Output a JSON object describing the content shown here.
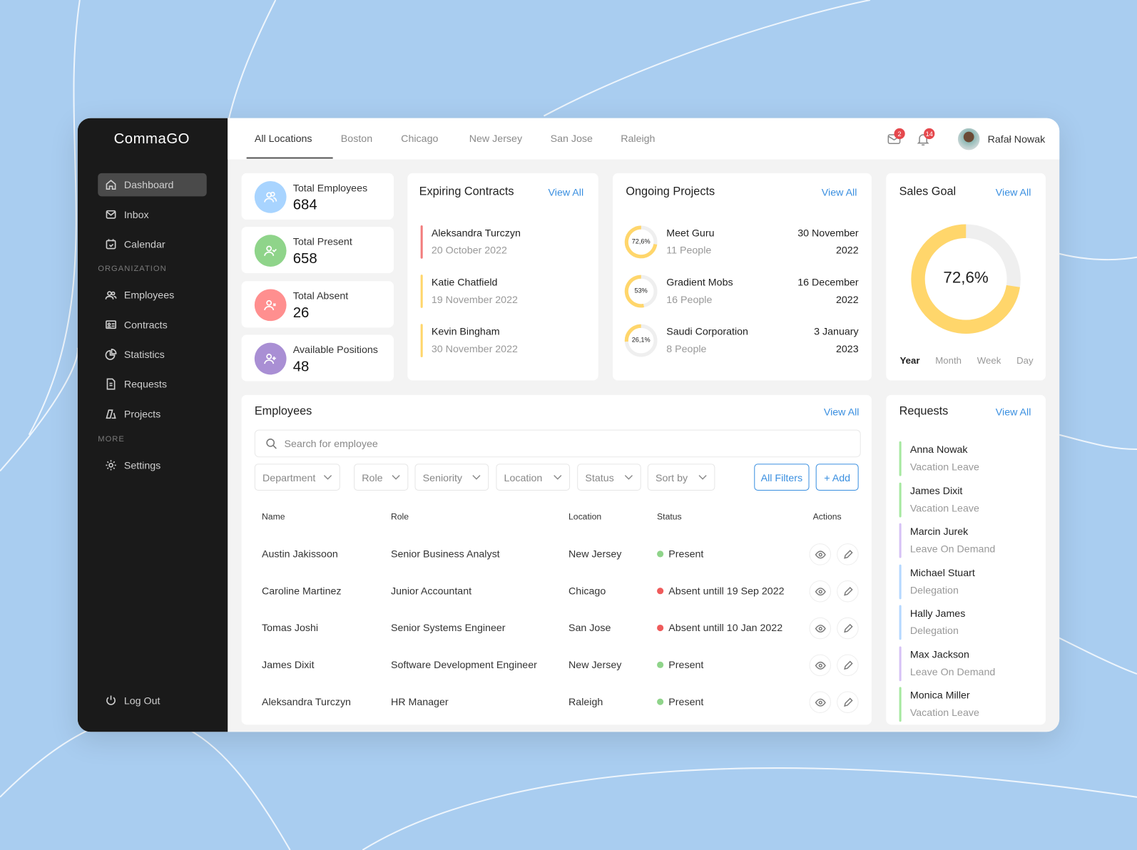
{
  "app": {
    "name": "CommaGO"
  },
  "sidebar": {
    "items": [
      {
        "label": "Dashboard",
        "icon": "home-icon"
      },
      {
        "label": "Inbox",
        "icon": "mail-icon"
      },
      {
        "label": "Calendar",
        "icon": "calendar-icon"
      }
    ],
    "section_org": "ORGANIZATION",
    "org_items": [
      {
        "label": "Employees"
      },
      {
        "label": "Contracts"
      },
      {
        "label": "Statistics"
      },
      {
        "label": "Requests"
      },
      {
        "label": "Projects"
      }
    ],
    "section_more": "MORE",
    "more_items": [
      {
        "label": "Settings"
      }
    ],
    "logout": "Log Out"
  },
  "tabs": [
    "All Locations",
    "Boston",
    "Chicago",
    "New Jersey",
    "San Jose",
    "Raleigh"
  ],
  "header": {
    "mail_count": "2",
    "notif_count": "14",
    "user_name": "Rafał Nowak"
  },
  "stats": [
    {
      "label": "Total Employees",
      "value": "684",
      "color": "#a8d4ff"
    },
    {
      "label": "Total Present",
      "value": "658",
      "color": "#8fd48a"
    },
    {
      "label": "Total Absent",
      "value": "26",
      "color": "#ff8f8f"
    },
    {
      "label": "Available Positions",
      "value": "48",
      "color": "#a98fd4"
    }
  ],
  "contracts": {
    "title": "Expiring Contracts",
    "view_all": "View All",
    "items": [
      {
        "name": "Aleksandra Turczyn",
        "date": "20 October 2022",
        "color": "#f27c7c"
      },
      {
        "name": "Katie Chatfield",
        "date": "19 November 2022",
        "color": "#ffd66b"
      },
      {
        "name": "Kevin Bingham",
        "date": "30 November 2022",
        "color": "#ffd66b"
      }
    ]
  },
  "projects": {
    "title": "Ongoing Projects",
    "view_all": "View All",
    "items": [
      {
        "name": "Meet Guru",
        "people": "11 People",
        "date1": "30 November",
        "date2": "2022",
        "pct_label": "72,6%",
        "pct": 72.6
      },
      {
        "name": "Gradient Mobs",
        "people": "16 People",
        "date1": "16 December",
        "date2": "2022",
        "pct_label": "53%",
        "pct": 53
      },
      {
        "name": "Saudi Corporation",
        "people": "8 People",
        "date1": "3 January",
        "date2": "2023",
        "pct_label": "26,1%",
        "pct": 26.1
      }
    ]
  },
  "sales": {
    "title": "Sales Goal",
    "view_all": "View All",
    "value_label": "72,6%",
    "value": 72.6,
    "periods": [
      "Year",
      "Month",
      "Week",
      "Day"
    ],
    "active_period": "Year"
  },
  "employees": {
    "title": "Employees",
    "view_all": "View All",
    "search_placeholder": "Search for employee",
    "filters": [
      "Department",
      "Role",
      "Seniority",
      "Location",
      "Status",
      "Sort by"
    ],
    "all_filters": "All Filters",
    "add": "+ Add",
    "columns": [
      "Name",
      "Role",
      "Location",
      "Status",
      "Actions"
    ],
    "rows": [
      {
        "name": "Austin Jakissoon",
        "role": "Senior Business Analyst",
        "location": "New Jersey",
        "status": "Present",
        "present": true
      },
      {
        "name": "Caroline Martinez",
        "role": "Junior Accountant",
        "location": "Chicago",
        "status": "Absent untill 19 Sep 2022",
        "present": false
      },
      {
        "name": "Tomas Joshi",
        "role": "Senior Systems Engineer",
        "location": "San Jose",
        "status": "Absent untill 10 Jan 2022",
        "present": false
      },
      {
        "name": "James Dixit",
        "role": "Software Development Engineer",
        "location": "New Jersey",
        "status": "Present",
        "present": true
      },
      {
        "name": "Aleksandra Turczyn",
        "role": "HR Manager",
        "location": "Raleigh",
        "status": "Present",
        "present": true
      }
    ]
  },
  "requests": {
    "title": "Requests",
    "view_all": "View All",
    "items": [
      {
        "name": "Anna Nowak",
        "type": "Vacation Leave",
        "color": "#a6e8a0"
      },
      {
        "name": "James Dixit",
        "type": "Vacation Leave",
        "color": "#a6e8a0"
      },
      {
        "name": "Marcin Jurek",
        "type": "Leave On Demand",
        "color": "#d6c2f5"
      },
      {
        "name": "Michael Stuart",
        "type": "Delegation",
        "color": "#b5d8ff"
      },
      {
        "name": "Hally James",
        "type": "Delegation",
        "color": "#b5d8ff"
      },
      {
        "name": "Max Jackson",
        "type": "Leave On Demand",
        "color": "#d6c2f5"
      },
      {
        "name": "Monica Miller",
        "type": "Vacation Leave",
        "color": "#a6e8a0"
      }
    ]
  }
}
